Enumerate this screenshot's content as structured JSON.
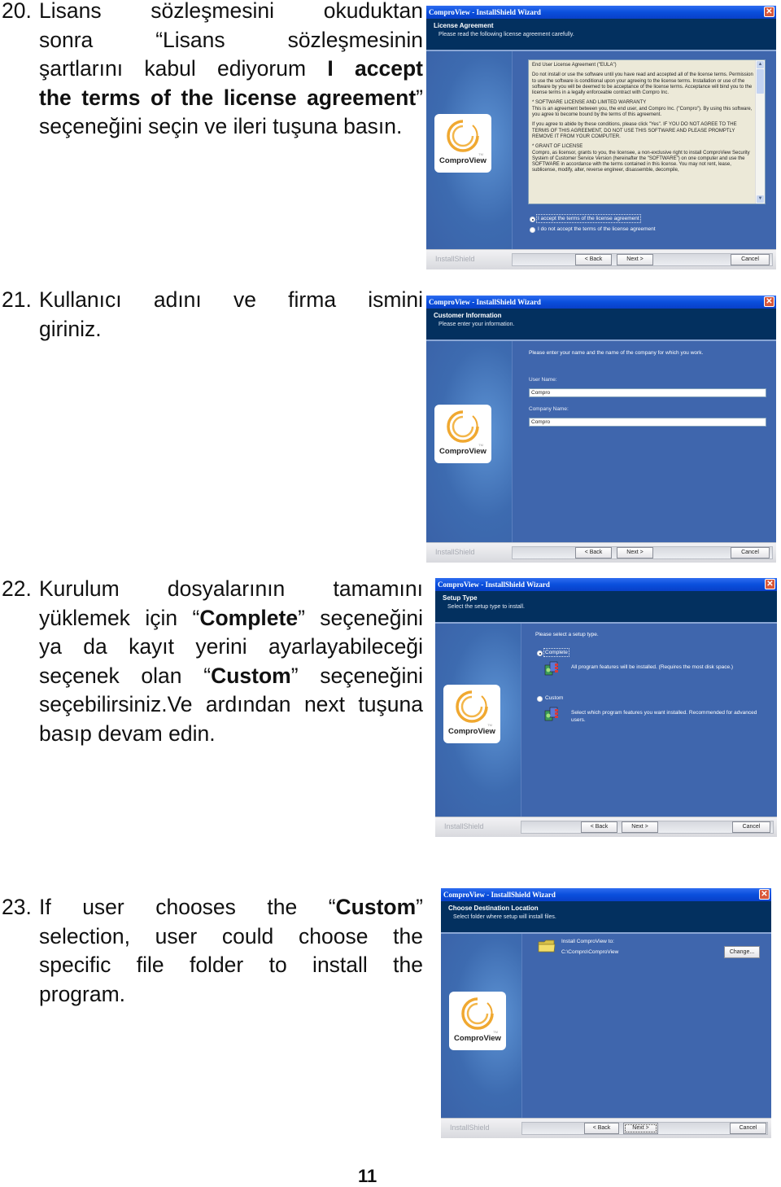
{
  "page_number": "11",
  "steps": [
    {
      "number": "20.",
      "lines": [
        [
          {
            "t": "Lisans sözleşmesini okuduktan"
          }
        ],
        [
          {
            "t": "sonra “Lisans sözleşmesinin"
          }
        ],
        [
          {
            "t": "şartlarını kabul ediyorum "
          },
          {
            "t": "I accept",
            "b": true
          }
        ],
        [
          {
            "t": "the terms of the license agreement",
            "b": true
          },
          {
            "t": "”"
          }
        ],
        [
          {
            "t": "seçeneğini seçin ve ileri tuşuna basın."
          }
        ]
      ]
    },
    {
      "number": "21.",
      "lines": [
        [
          {
            "t": "Kullanıcı adını ve firma ismini"
          }
        ],
        [
          {
            "t": "giriniz."
          }
        ]
      ]
    },
    {
      "number": "22.",
      "lines": [
        [
          {
            "t": "Kurulum dosyalarının tamamını"
          }
        ],
        [
          {
            "t": "yüklemek için “"
          },
          {
            "t": "Complete",
            "b": true
          },
          {
            "t": "” seçeneğini"
          }
        ],
        [
          {
            "t": "ya da kayıt yerini ayarlayabileceği"
          }
        ],
        [
          {
            "t": "seçenek olan “"
          },
          {
            "t": "Custom",
            "b": true
          },
          {
            "t": "” seçeneğini"
          }
        ],
        [
          {
            "t": "seçebilirsiniz.Ve ardından next tuşuna"
          }
        ],
        [
          {
            "t": "basıp devam edin."
          }
        ]
      ]
    },
    {
      "number": "23.",
      "lines": [
        [
          {
            "t": "If user chooses the “"
          },
          {
            "t": "Custom",
            "b": true
          },
          {
            "t": "”"
          }
        ],
        [
          {
            "t": "selection, user could choose the"
          }
        ],
        [
          {
            "t": "specific file folder to install the"
          }
        ],
        [
          {
            "t": "program."
          }
        ]
      ]
    }
  ],
  "wizard_common": {
    "window_title": "ComproView - InstallShield Wizard",
    "close_glyph": "✕",
    "logo_text": "ComproView",
    "logo_tm": "TM",
    "footer_brand": "InstallShield",
    "back_label": "< Back",
    "next_label": "Next >",
    "cancel_label": "Cancel"
  },
  "wizards": {
    "license": {
      "header_title": "License Agreement",
      "header_subtitle": "Please read the following license agreement carefully.",
      "eula_paragraphs": [
        "End User License Agreement (\"EULA\")",
        "Do not install or use the software until you have read and accepted all of the license terms. Permission to use the software is conditional upon your agreeing to the license terms. Installation or use of the software by you will be deemed to be acceptance of the license terms. Acceptance will bind you to the license terms in a legally enforceable contract with Compro Inc.",
        "* SOFTWARE LICENSE AND LIMITED WARRANTY\nThis is an agreement between you, the end user, and Compro Inc. (\"Compro\"). By using this software, you agree to become bound by the terms of this agreement.",
        "If you agree to abide by these conditions, please click \"Yes\". IF YOU DO NOT AGREE TO THE TERMS OF THIS AGREEMENT, DO NOT USE THIS SOFTWARE AND PLEASE PROMPTLY REMOVE IT FROM YOUR COMPUTER.",
        "* GRANT OF LICENSE\nCompro, as licensor, grants to you, the licensee, a non-exclusive right to install ComproView Security System of Customer Service Version (hereinafter the \"SOFTWARE\") on one computer and use the SOFTWARE in accordance with the terms contained in this license. You may not rent, lease, sublicense, modify, alter, reverse engineer, disassemble, decompile,"
      ],
      "radio_accept": "I accept the terms of the license agreement",
      "radio_decline": "I do not accept the terms of the license agreement",
      "selected": "accept"
    },
    "customer": {
      "header_title": "Customer Information",
      "header_subtitle": "Please enter your information.",
      "prompt": "Please enter your name and the name of the company for which you work.",
      "user_name_label": "User Name:",
      "user_name_value": "Compro",
      "company_name_label": "Company Name:",
      "company_name_value": "Compro"
    },
    "setup_type": {
      "header_title": "Setup Type",
      "header_subtitle": "Select the setup type to install.",
      "prompt": "Please select a setup type.",
      "complete_label": "Complete",
      "complete_desc": "All program features will be installed. (Requires the most disk space.)",
      "custom_label": "Custom",
      "custom_desc": "Select which program features you want installed. Recommended for advanced users.",
      "selected": "complete"
    },
    "destination": {
      "header_title": "Choose Destination Location",
      "header_subtitle": "Select folder where setup will install files.",
      "install_to_label": "Install ComproView to:",
      "install_path": "C:\\Compro\\ComproView",
      "change_label": "Change..."
    }
  },
  "colors": {
    "titlebar": "#0a4fdc",
    "header_band": "#03305f",
    "content_bg": "#3f66ad",
    "logo_ring": "#f0a830",
    "close_button": "#d9583a"
  }
}
